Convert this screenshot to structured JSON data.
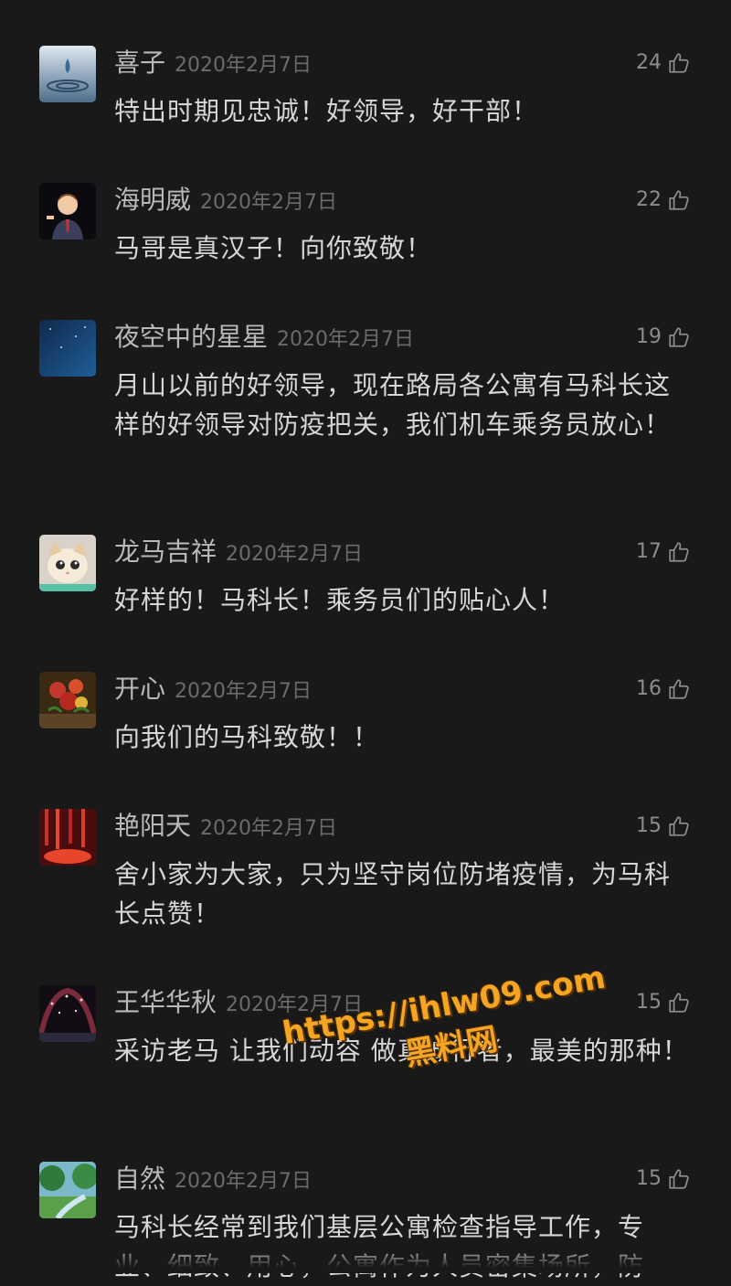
{
  "comments": [
    {
      "name": "喜子",
      "date": "2020年2月7日",
      "likes": "24",
      "text": "特出时期见忠诚！好领导，好干部！",
      "avatar_icon": "water-drop-avatar"
    },
    {
      "name": "海明威",
      "date": "2020年2月7日",
      "likes": "22",
      "text": "马哥是真汉子！向你致敬！",
      "avatar_icon": "cartoon-man-avatar"
    },
    {
      "name": "夜空中的星星",
      "date": "2020年2月7日",
      "likes": "19",
      "text": "月山以前的好领导，现在路局各公寓有马科长这样的好领导对防疫把关，我们机车乘务员放心！",
      "avatar_icon": "night-sky-avatar"
    },
    {
      "name": "龙马吉祥",
      "date": "2020年2月7日",
      "likes": "17",
      "text": "好样的！马科长！乘务员们的贴心人！",
      "avatar_icon": "cat-avatar"
    },
    {
      "name": "开心",
      "date": "2020年2月7日",
      "likes": "16",
      "text": "向我们的马科致敬！！",
      "avatar_icon": "flower-avatar"
    },
    {
      "name": "艳阳天",
      "date": "2020年2月7日",
      "likes": "15",
      "text": "舍小家为大家，只为坚守岗位防堵疫情，为马科长点赞！",
      "avatar_icon": "red-scene-avatar"
    },
    {
      "name": "王华华秋",
      "date": "2020年2月7日",
      "likes": "15",
      "text": "采访老马 让我们动容 做真诚行者，最美的那种！",
      "avatar_icon": "tree-tunnel-avatar"
    },
    {
      "name": "自然",
      "date": "2020年2月7日",
      "likes": "15",
      "text": "马科长经常到我们基层公寓检查指导工作，专业、细致、用心，公寓作为人员密集场所，防",
      "avatar_icon": "nature-avatar"
    }
  ],
  "watermark": {
    "url": "https://ihlw09.com",
    "name": "黑料网"
  },
  "colors": {
    "background": "#191919",
    "name": "#b9b9b9",
    "date": "#6b6b6b",
    "text": "#d6d6d6",
    "watermark": "#f5a524"
  }
}
